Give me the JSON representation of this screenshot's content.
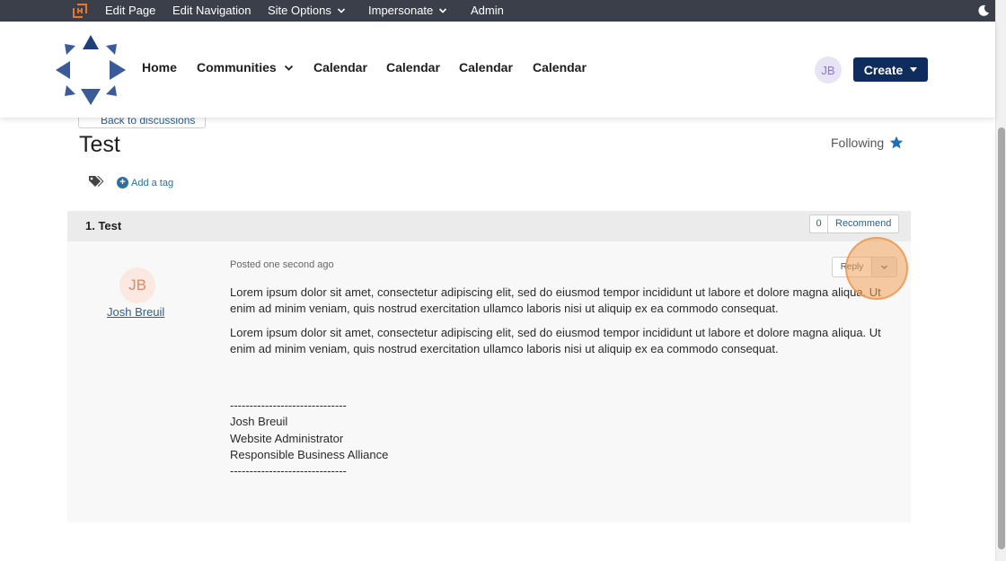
{
  "admin_bar": {
    "items": [
      {
        "label": "Edit Page"
      },
      {
        "label": "Edit Navigation"
      },
      {
        "label": "Site Options"
      },
      {
        "label": "Impersonate"
      },
      {
        "label": "Admin"
      }
    ]
  },
  "nav": {
    "items": [
      {
        "label": "Home"
      },
      {
        "label": "Communities"
      },
      {
        "label": "Calendar"
      },
      {
        "label": "Calendar"
      },
      {
        "label": "Calendar"
      },
      {
        "label": "Calendar"
      }
    ],
    "user_initials": "JB",
    "create_label": "Create"
  },
  "discussion": {
    "back_label": "Back to discussions",
    "title": "Test",
    "following_label": "Following",
    "add_tag_label": "Add a tag",
    "thread": {
      "index_title": "1.  Test",
      "recommend_count": "0",
      "recommend_label": "Recommend"
    }
  },
  "post": {
    "author_initials": "JB",
    "author_name": "Josh Breuil",
    "posted": "Posted one second ago",
    "reply_label": "Reply",
    "paragraphs": [
      "Lorem ipsum dolor sit amet, consectetur adipiscing elit, sed do eiusmod tempor incididunt ut labore et dolore magna aliqua. Ut enim ad minim veniam, quis nostrud exercitation ullamco laboris nisi ut aliquip ex ea commodo consequat.",
      "Lorem ipsum dolor sit amet, consectetur adipiscing elit, sed do eiusmod tempor incididunt ut labore et dolore magna aliqua. Ut enim ad minim veniam, quis nostrud exercitation ullamco laboris nisi ut aliquip ex ea commodo consequat."
    ],
    "signature": {
      "divider_top": "------------------------------",
      "name": "Josh Breuil",
      "role": "Website Administrator",
      "org": "Responsible Business Alliance",
      "divider_bottom": "------------------------------"
    }
  },
  "colors": {
    "admin_bar": "#3a3f4a",
    "create_button": "#0f2d5c",
    "link": "#2d5f8e",
    "star": "#1f6fb8",
    "logo": "#3a5a9a"
  }
}
